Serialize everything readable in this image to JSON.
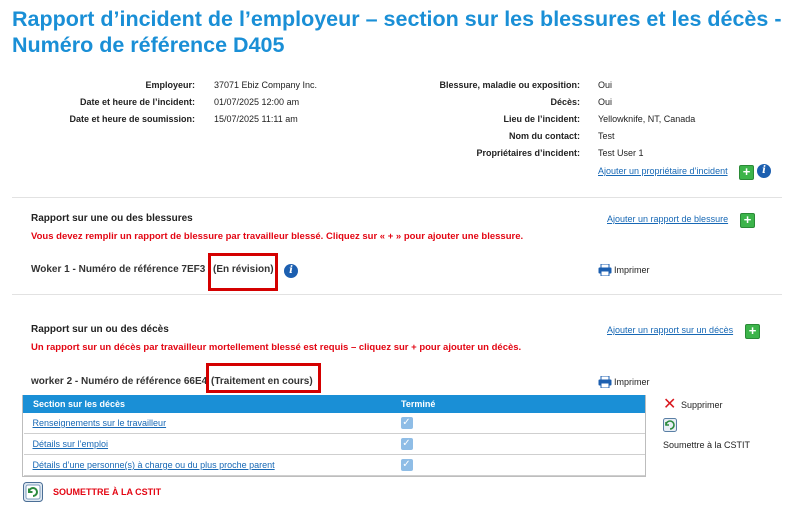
{
  "page": {
    "title_line1": "Rapport d’incident de l’employeur – section sur les blessures et les décès -",
    "title_line2": "Numéro de référence D405"
  },
  "summary_left": [
    {
      "label": "Employeur:",
      "value": "37071 Ebiz Company Inc."
    },
    {
      "label": "Date et heure de l’incident:",
      "value": "01/07/2025 12:00 am"
    },
    {
      "label": "Date et heure de soumission:",
      "value": "15/07/2025 11:11 am"
    }
  ],
  "summary_right": [
    {
      "label": "Blessure, maladie ou exposition:",
      "value": "Oui"
    },
    {
      "label": "Décès:",
      "value": "Oui"
    },
    {
      "label": "Lieu de l’incident:",
      "value": "Yellowknife, NT, Canada"
    },
    {
      "label": "Nom du contact:",
      "value": "Test"
    },
    {
      "label": "Propriétaires d’incident:",
      "value": "Test User 1"
    }
  ],
  "owner": {
    "add_link": "Ajouter un propriétaire d’incident"
  },
  "injury_section": {
    "title": "Rapport sur une ou des blessures",
    "add_link": "Ajouter un rapport de blessure",
    "warning": "Vous devez remplir un rapport de blessure par travailleur blessé. Cliquez sur « + » pour ajouter une blessure.",
    "worker_label": "Woker 1 - Numéro de référence 7EF3",
    "worker_status": "(En révision)",
    "print_label": "Imprimer"
  },
  "death_section": {
    "title": "Rapport sur un ou des décès",
    "add_link": "Ajouter un rapport sur un décès",
    "warning": "Un rapport sur un décès par travailleur mortellement blessé est requis – cliquez sur + pour ajouter un décès.",
    "worker_label": "worker 2 - Numéro de référence 66E4",
    "worker_status": "(Traitement en cours)",
    "print_label": "Imprimer",
    "table": {
      "headers": [
        "Section sur les décès",
        "Terminé"
      ],
      "rows": [
        {
          "label": "Renseignements sur le travailleur",
          "done": true
        },
        {
          "label": "Détails sur l’emploi",
          "done": true
        },
        {
          "label": "Détails d’une personne(s) à charge ou du plus proche parent",
          "done": true
        }
      ]
    },
    "delete_label": "Supprimer",
    "submit_side_label": "Soumettre à la CSTIT"
  },
  "footer": {
    "submit_label": "SOUMETTRE À LA CSTIT"
  },
  "icons": {
    "plus": "plus-icon",
    "info": "info-icon",
    "print": "printer-icon",
    "delete": "x-icon",
    "submit": "submit-icon"
  },
  "colors": {
    "title_blue": "#1a8fd6",
    "link_blue": "#1768b5",
    "warning_red": "#e30613",
    "highlight_red": "#d40000",
    "add_green": "#3cb44a"
  }
}
